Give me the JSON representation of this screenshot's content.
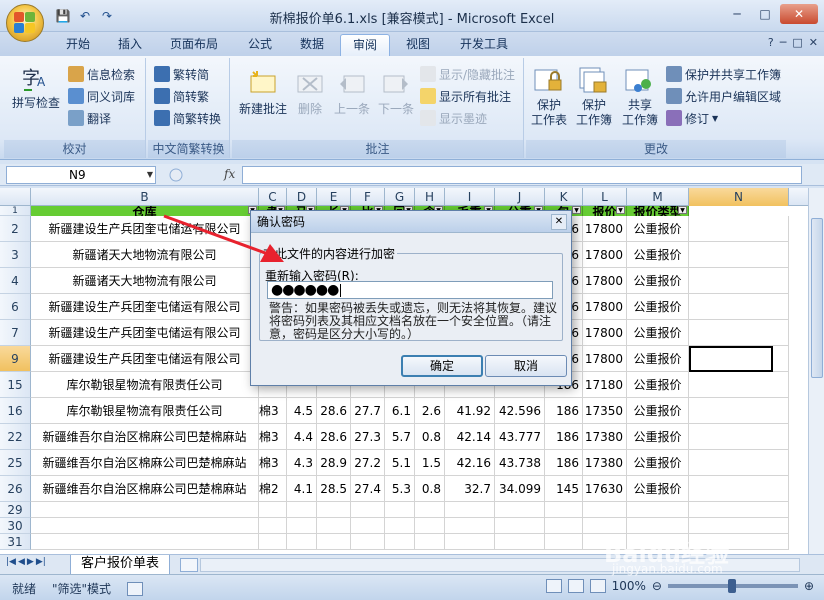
{
  "window": {
    "title": "新棉报价单6.1.xls  [兼容模式] - Microsoft Excel",
    "minimize": "─",
    "maximize": "□",
    "close": "✕"
  },
  "qat": {
    "save": "💾",
    "undo": "↶",
    "redo": "↷"
  },
  "ribbon": {
    "tabs": [
      "开始",
      "插入",
      "页面布局",
      "公式",
      "数据",
      "审阅",
      "视图",
      "开发工具"
    ],
    "active_tab": "审阅",
    "right_controls": [
      "?",
      "─",
      "□",
      "✕"
    ],
    "groups": {
      "proofing": {
        "label": "校对",
        "spelling": "拼写检查",
        "research": "信息检索",
        "thesaurus": "同义词库",
        "translate": "翻译"
      },
      "chinese": {
        "label": "中文简繁转换",
        "to_simplified": "繁转简",
        "to_traditional": "简转繁",
        "convert": "简繁转换"
      },
      "comments": {
        "label": "批注",
        "new": "新建批注",
        "delete": "删除",
        "previous": "上一条",
        "next": "下一条",
        "show_hide": "显示/隐藏批注",
        "show_all": "显示所有批注",
        "show_ink": "显示墨迹"
      },
      "changes": {
        "label": "更改",
        "protect_sheet": "保护\n工作表",
        "protect_workbook": "保护\n工作簿",
        "share_workbook": "共享\n工作簿",
        "protect_share": "保护并共享工作簿",
        "allow_edit": "允许用户编辑区域",
        "track": "修订"
      }
    }
  },
  "formula_bar": {
    "name_box": "N9",
    "fx": "fx"
  },
  "sheet": {
    "columns": [
      "B",
      "C",
      "D",
      "E",
      "F",
      "G",
      "H",
      "I",
      "J",
      "K",
      "L",
      "M",
      "N"
    ],
    "header_row": [
      "仓库",
      "考",
      "马",
      "长",
      "比",
      "回",
      "含",
      "毛重",
      "公重",
      "包",
      "报价",
      "报价类型"
    ],
    "rows": [
      {
        "num": "2",
        "b": "新疆建设生产兵团奎屯储运有限公司",
        "k": "186",
        "l": "17800",
        "m": "公重报价"
      },
      {
        "num": "3",
        "b": "新疆诸天大地物流有限公司",
        "k": "186",
        "l": "17800",
        "m": "公重报价"
      },
      {
        "num": "4",
        "b": "新疆诸天大地物流有限公司",
        "k": "186",
        "l": "17800",
        "m": "公重报价"
      },
      {
        "num": "6",
        "b": "新疆建设生产兵团奎屯储运有限公司",
        "k": "186",
        "l": "17800",
        "m": "公重报价"
      },
      {
        "num": "7",
        "b": "新疆建设生产兵团奎屯储运有限公司",
        "k": "186",
        "l": "17800",
        "m": "公重报价"
      },
      {
        "num": "9",
        "b": "新疆建设生产兵团奎屯储运有限公司",
        "k": "186",
        "l": "17800",
        "m": "公重报价"
      },
      {
        "num": "15",
        "b": "库尔勒银星物流有限责任公司",
        "k": "186",
        "l": "17180",
        "m": "公重报价"
      },
      {
        "num": "16",
        "b": "库尔勒银星物流有限责任公司",
        "c": "棉3",
        "d": "4.5",
        "e": "28.6",
        "f": "27.7",
        "g": "6.1",
        "h": "2.6",
        "i": "41.92",
        "j": "42.596",
        "k": "186",
        "l": "17350",
        "m": "公重报价"
      },
      {
        "num": "22",
        "b": "新疆维吾尔自治区棉麻公司巴楚棉麻站",
        "c": "棉3",
        "d": "4.4",
        "e": "28.6",
        "f": "27.3",
        "g": "5.7",
        "h": "0.8",
        "i": "42.14",
        "j": "43.777",
        "k": "186",
        "l": "17380",
        "m": "公重报价"
      },
      {
        "num": "25",
        "b": "新疆维吾尔自治区棉麻公司巴楚棉麻站",
        "c": "棉3",
        "d": "4.3",
        "e": "28.9",
        "f": "27.2",
        "g": "5.1",
        "h": "1.5",
        "i": "42.16",
        "j": "43.738",
        "k": "186",
        "l": "17380",
        "m": "公重报价"
      },
      {
        "num": "26",
        "b": "新疆维吾尔自治区棉麻公司巴楚棉麻站",
        "c": "棉2",
        "d": "4.1",
        "e": "28.5",
        "f": "27.4",
        "g": "5.3",
        "h": "0.8",
        "i": "32.7",
        "j": "34.099",
        "k": "145",
        "l": "17630",
        "m": "公重报价"
      },
      {
        "num": "29"
      },
      {
        "num": "30"
      },
      {
        "num": "31"
      }
    ],
    "header_row_num": "1",
    "selected_row": "9",
    "selected_col": "N"
  },
  "dialog": {
    "title": "确认密码",
    "close": "✕",
    "caption": "对此文件的内容进行加密",
    "label": "重新输入密码(R):",
    "password_mask": "●●●●●●",
    "warning": "警告：如果密码被丢失或遗忘，则无法将其恢复。建议将密码列表及其相应文档名放在一个安全位置。（请注意，密码是区分大小写的。）",
    "ok": "确定",
    "cancel": "取消"
  },
  "sheet_tabs": {
    "active": "客户报价单表",
    "nav": [
      "|◀",
      "◀",
      "▶",
      "▶|"
    ]
  },
  "statusbar": {
    "ready": "就绪",
    "mode": "\"筛选\"模式",
    "zoom": "100%",
    "minus": "⊖",
    "plus": "⊕"
  },
  "watermark": {
    "brand": "Baidu经验",
    "url": "jingyan.baidu.com"
  },
  "colors": {
    "header_green": "#66cc33",
    "accent": "#1f4e8c",
    "arrow": "#e8222e"
  }
}
